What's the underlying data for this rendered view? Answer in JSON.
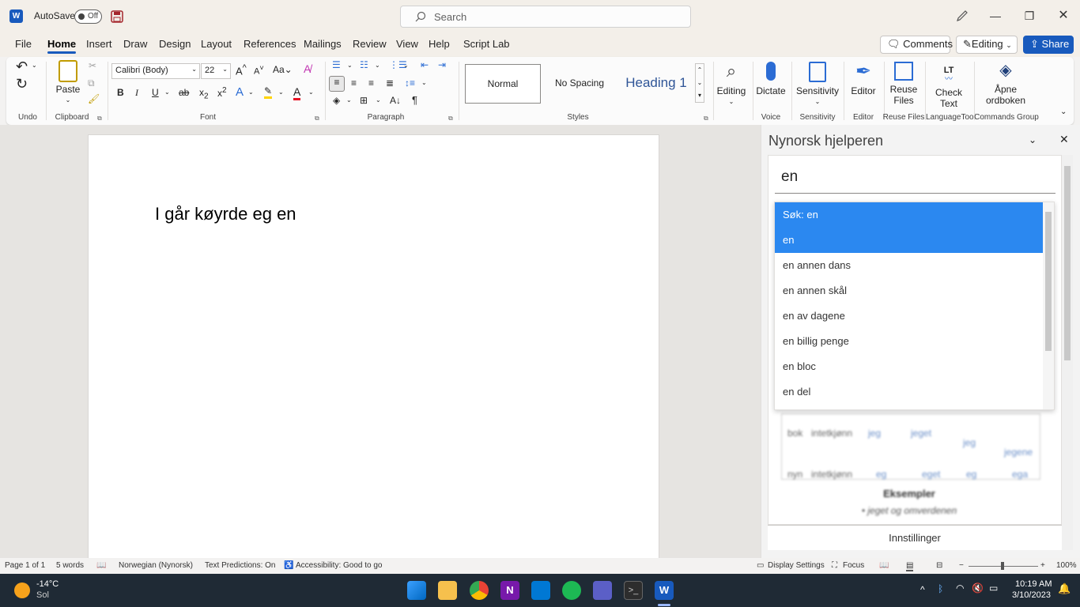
{
  "titlebar": {
    "autosave_label": "AutoSave",
    "autosave_state": "Off",
    "search_placeholder": "Search"
  },
  "menu": {
    "tabs": [
      "File",
      "Home",
      "Insert",
      "Draw",
      "Design",
      "Layout",
      "References",
      "Mailings",
      "Review",
      "View",
      "Help",
      "Script Lab"
    ],
    "active_tab": "Home",
    "comments_label": "Comments",
    "editing_label": "Editing",
    "share_label": "Share"
  },
  "ribbon": {
    "groups": {
      "undo": "Undo",
      "clipboard": "Clipboard",
      "font": "Font",
      "paragraph": "Paragraph",
      "styles": "Styles",
      "voice": "Voice",
      "sensitivity": "Sensitivity",
      "editor": "Editor",
      "reuse_files": "Reuse Files",
      "languagetool": "LanguageTool",
      "commands_group": "Commands Group"
    },
    "paste_label": "Paste",
    "font_name": "Calibri (Body)",
    "font_size": "22",
    "styles": [
      "Normal",
      "No Spacing",
      "Heading 1"
    ],
    "editing_btn": "Editing",
    "dictate_btn": "Dictate",
    "sensitivity_btn": "Sensitivity",
    "editor_btn": "Editor",
    "reuse_btn_line1": "Reuse",
    "reuse_btn_line2": "Files",
    "check_btn_line1": "Check",
    "check_btn_line2": "Text",
    "apne_btn_line1": "Åpne",
    "apne_btn_line2": "ordboken",
    "lt_logo": "LT"
  },
  "document": {
    "text": "I går køyrde eg en"
  },
  "pane": {
    "title": "Nynorsk hjelperen",
    "search_value": "en",
    "suggestions": [
      "Søk: en",
      "en",
      "en annen dans",
      "en annen skål",
      "en av dagene",
      "en billig penge",
      "en bloc",
      "en del"
    ],
    "selected_count": 2,
    "blurred_rows": [
      [
        "bok",
        "intetkjønn",
        "jeg",
        "jeget",
        "jeg",
        "jegene"
      ],
      [
        "nyn",
        "intetkjønn",
        "eg",
        "eget",
        "eg",
        "ega"
      ]
    ],
    "blurred_heading": "Eksempler",
    "blurred_example": "• jeget og omverdenen",
    "footer": "Innstillinger"
  },
  "status": {
    "page": "Page 1 of 1",
    "words": "5 words",
    "language": "Norwegian (Nynorsk)",
    "predictions": "Text Predictions: On",
    "accessibility": "Accessibility: Good to go",
    "display_settings": "Display Settings",
    "focus": "Focus",
    "zoom": "100%"
  },
  "taskbar": {
    "temp": "-14°C",
    "weather": "Sol",
    "time": "10:19 AM",
    "date": "3/10/2023"
  }
}
